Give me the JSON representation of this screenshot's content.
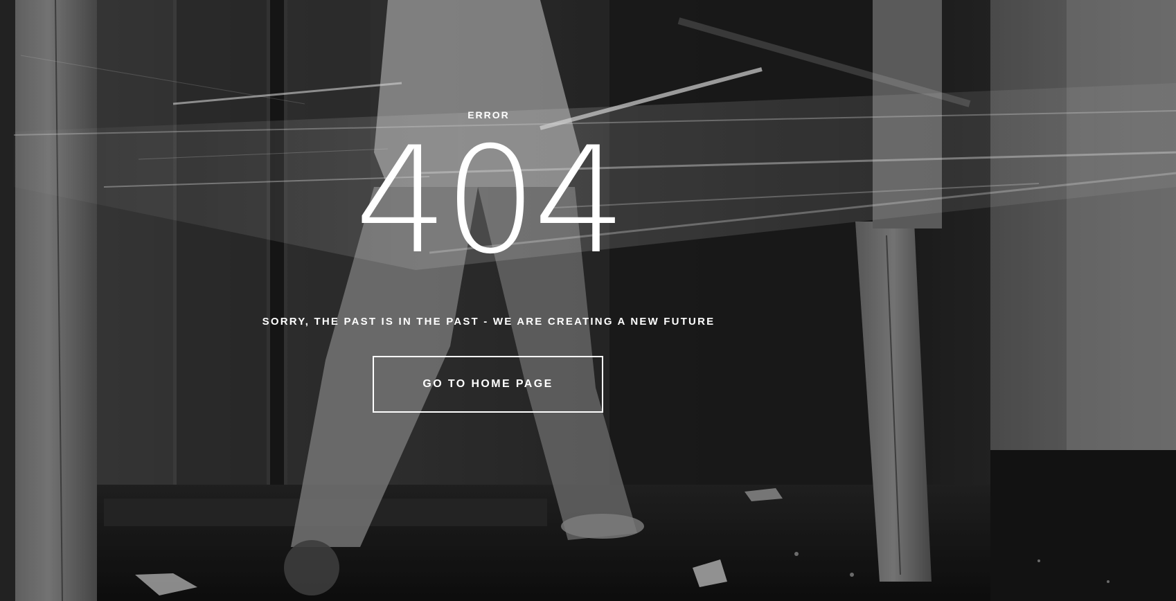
{
  "page": {
    "eyebrow": "ERROR",
    "code": "404",
    "message": "SORRY, THE PAST IS IN THE PAST - WE ARE CREATING A NEW FUTURE",
    "home_button_label": "GO TO HOME PAGE"
  },
  "colors": {
    "text": "#ffffff",
    "background": "#1c1c1c"
  },
  "background_image": {
    "depicts": "black-and-white photo of a person smashing through a glass pane between wooden posts"
  }
}
